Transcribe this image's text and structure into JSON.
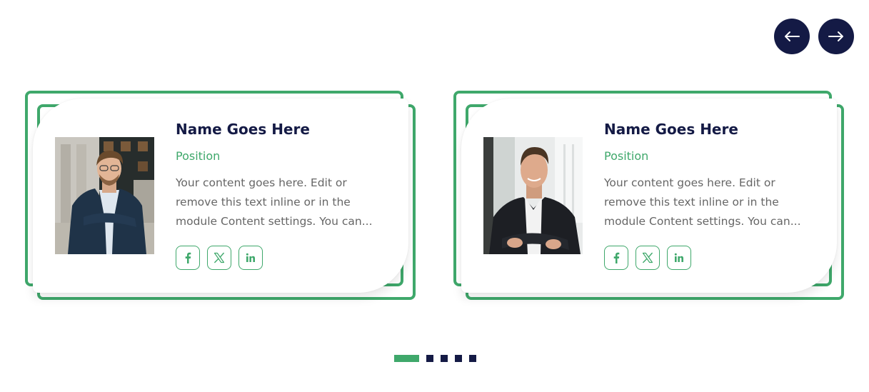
{
  "slider": {
    "prev_label": "Previous slide",
    "next_label": "Next slide"
  },
  "cards": [
    {
      "name": "Name Goes Here",
      "position": "Position",
      "description_lines": [
        "Your content goes here. Edit or",
        "remove this text inline or in the",
        "module Content settings. You can..."
      ],
      "social": [
        "facebook-icon",
        "x-icon",
        "linkedin-icon"
      ]
    },
    {
      "name": "Name Goes Here",
      "position": "Position",
      "description_lines": [
        "Your content goes here. Edit or",
        "remove this text inline or in the",
        "module Content settings. You can..."
      ],
      "social": [
        "facebook-icon",
        "x-icon",
        "linkedin-icon"
      ]
    }
  ],
  "pagination": {
    "count": 5,
    "active_index": 0
  },
  "colors": {
    "accent": "#3fa86b",
    "navy": "#141a45",
    "text": "#666666"
  }
}
